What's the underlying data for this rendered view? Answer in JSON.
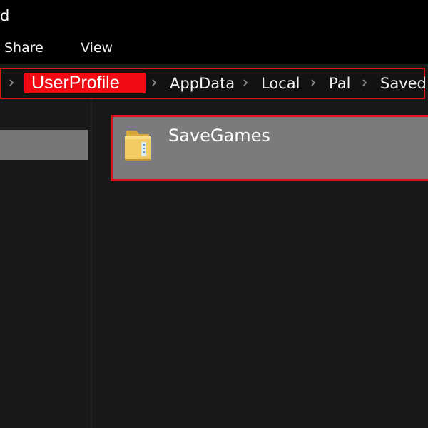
{
  "window": {
    "title_fragment": "d"
  },
  "ribbon": {
    "tabs": [
      "Share",
      "View"
    ]
  },
  "address_bar": {
    "crumbs": [
      "UserProfile",
      "AppData",
      "Local",
      "Pal",
      "Saved"
    ],
    "separator_icon": "chevron-right-icon",
    "highlight_color": "#f10a13",
    "border_color": "#e0131d"
  },
  "content": {
    "items": [
      {
        "name": "SaveGames",
        "icon": "folder-icon",
        "selected": true
      }
    ]
  },
  "colors": {
    "background": "#191919",
    "titlebar": "#000000",
    "selection": "#7b7b7b",
    "accent_red": "#e0131d"
  }
}
